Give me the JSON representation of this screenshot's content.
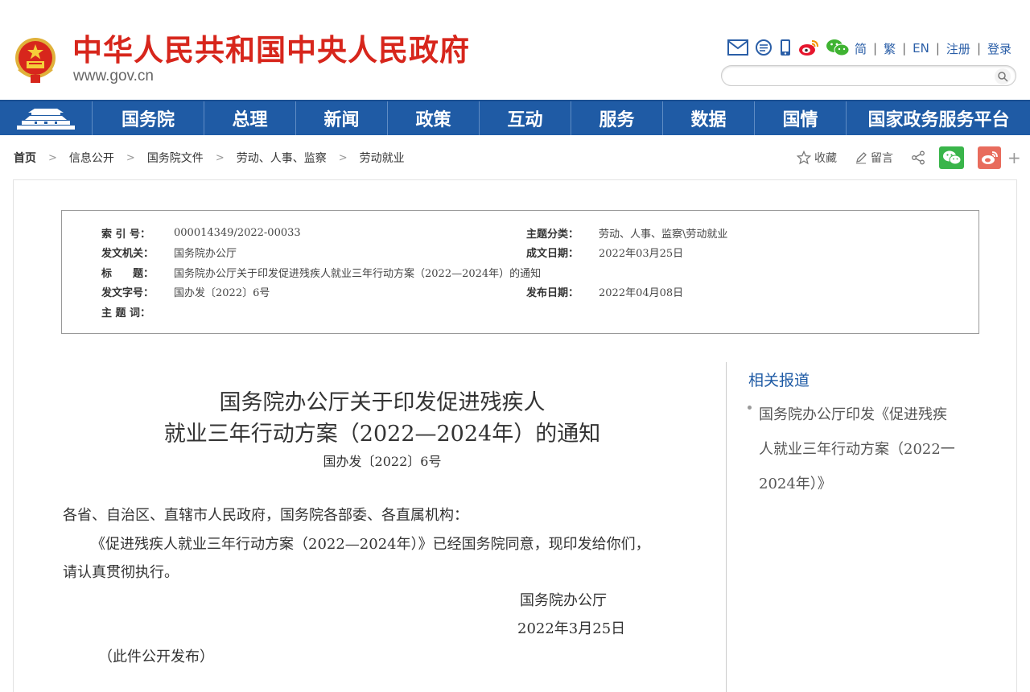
{
  "header": {
    "site_title": "中华人民共和国中央人民政府",
    "site_url": "www.gov.cn",
    "icons": [
      "mail-icon",
      "message-icon",
      "mobile-icon",
      "weibo-icon",
      "wechat-icon"
    ],
    "links": [
      "简",
      "繁",
      "EN",
      "注册",
      "登录"
    ],
    "search_placeholder": ""
  },
  "nav": {
    "items": [
      "国务院",
      "总理",
      "新闻",
      "政策",
      "互动",
      "服务",
      "数据",
      "国情",
      "国家政务服务平台"
    ]
  },
  "breadcrumb": {
    "items": [
      "首页",
      "信息公开",
      "国务院文件",
      "劳动、人事、监察",
      "劳动就业"
    ]
  },
  "share": {
    "favorite_label": "收藏",
    "comment_label": "留言"
  },
  "info": {
    "index_label": "索 引 号：",
    "index_value": "000014349/2022-00033",
    "topic_label": "主题分类：",
    "topic_value": "劳动、人事、监察\\劳动就业",
    "issuer_label": "发文机关：",
    "issuer_value": "国务院办公厅",
    "written_label": "成文日期：",
    "written_value": "2022年03月25日",
    "title_label": "标　　题：",
    "title_value": "国务院办公厅关于印发促进残疾人就业三年行动方案（2022—2024年）的通知",
    "docno_label": "发文字号：",
    "docno_value": "国办发〔2022〕6号",
    "published_label": "发布日期：",
    "published_value": "2022年04月08日",
    "keywords_label": "主 题 词："
  },
  "article": {
    "title_line1": "国务院办公厅关于印发促进残疾人",
    "title_line2": "就业三年行动方案（2022—2024年）的通知",
    "doc_no": "国办发〔2022〕6号",
    "salutation": "各省、自治区、直辖市人民政府，国务院各部委、各直属机构：",
    "body_line1": "《促进残疾人就业三年行动方案（2022—2024年）》已经国务院同意，现印发给你们，",
    "body_line2": "请认真贯彻执行。",
    "signer": "国务院办公厅",
    "date": "2022年3月25日",
    "note": "（此件公开发布）"
  },
  "sidebar": {
    "title": "相关报道",
    "link_line1": "国务院办公厅印发《促进残疾",
    "link_line2": "人就业三年行动方案（2022一",
    "link_line3": "2024年）》"
  },
  "colors": {
    "brand_red": "#d7261c",
    "nav_blue": "#1f5ba5",
    "link_blue": "#2a5ea7"
  }
}
